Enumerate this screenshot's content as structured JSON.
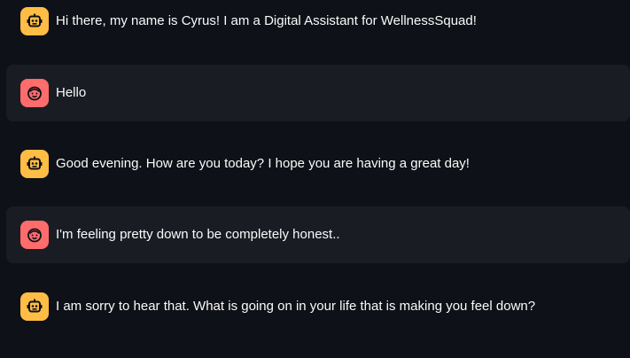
{
  "chat": {
    "messages": [
      {
        "role": "assistant",
        "avatar_icon": "robot-icon",
        "text": "Hi there, my name is Cyrus! I am a Digital Assistant for WellnessSquad!"
      },
      {
        "role": "user",
        "avatar_icon": "smiley-face-icon",
        "text": "Hello"
      },
      {
        "role": "assistant",
        "avatar_icon": "robot-icon",
        "text": "Good evening. How are you today? I hope you are having a great day!"
      },
      {
        "role": "user",
        "avatar_icon": "smiley-face-icon",
        "text": "I'm feeling pretty down to be completely honest.."
      },
      {
        "role": "assistant",
        "avatar_icon": "robot-icon",
        "text": "I am sorry to hear that. What is going on in your life that is making you feel down?"
      }
    ]
  },
  "colors": {
    "background": "#0e1117",
    "user_message_bg": "#1a1c24",
    "assistant_avatar": "#ffbd45",
    "user_avatar": "#ff6c6c",
    "text": "#fafafa"
  }
}
